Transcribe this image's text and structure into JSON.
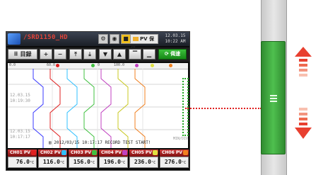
{
  "device": {
    "title_prefix": "",
    "title_model": "/SRD1150_HD",
    "pv_button_label": "PV 保存",
    "clock": {
      "date": "12.03.15",
      "time": "10:22 AM"
    },
    "toolbar": {
      "menu_label": "目録",
      "plus_label": "+",
      "minus_label": "−",
      "top_label": "⤒",
      "bottom_label": "⤓",
      "down_label": "▼",
      "up_label": "▲",
      "cursor_top_label": "▔",
      "cursor_bottom_label": "▁",
      "refresh_label": "偈速"
    }
  },
  "trend": {
    "markers": [
      {
        "text": "0.0",
        "color": "#3a3aff"
      },
      {
        "text": "60.0",
        "color": "#e02020"
      },
      {
        "text": "0",
        "color": "#30c0ff"
      },
      {
        "text": "100.0",
        "color": "#40c040"
      },
      {
        "text": "0",
        "color": "#c040c0"
      },
      {
        "text": "0",
        "color": "#e0e040"
      },
      {
        "text": "0",
        "color": "#f08020"
      }
    ],
    "time_labels": [
      {
        "date": "12.03.15",
        "time": "10:19:30"
      },
      {
        "date": "12.03.15",
        "time": "10:17:17"
      }
    ],
    "record_text": "2012/03/15 10:17:17 RECORD TEST START!",
    "side_text": "MIN/DIV"
  },
  "channels": [
    {
      "label": "CH01 PV",
      "value": "76.0",
      "unit": "°C",
      "color": "#e02020"
    },
    {
      "label": "CH02 PV",
      "value": "116.0",
      "unit": "°C",
      "color": "#30c0ff"
    },
    {
      "label": "CH03 PV",
      "value": "156.0",
      "unit": "°C",
      "color": "#40c040"
    },
    {
      "label": "CH04 PV",
      "value": "196.0",
      "unit": "°C",
      "color": "#c040c0"
    },
    {
      "label": "CH05 PV",
      "value": "236.0",
      "unit": "°C",
      "color": "#e0e040"
    },
    {
      "label": "CH06 PV",
      "value": "276.0",
      "unit": "°C",
      "color": "#f08020"
    }
  ],
  "scrollbar": {
    "thumb_color": "#3fab3f",
    "up_arrow_color": "#e84030",
    "down_arrow_color": "#e84030"
  }
}
